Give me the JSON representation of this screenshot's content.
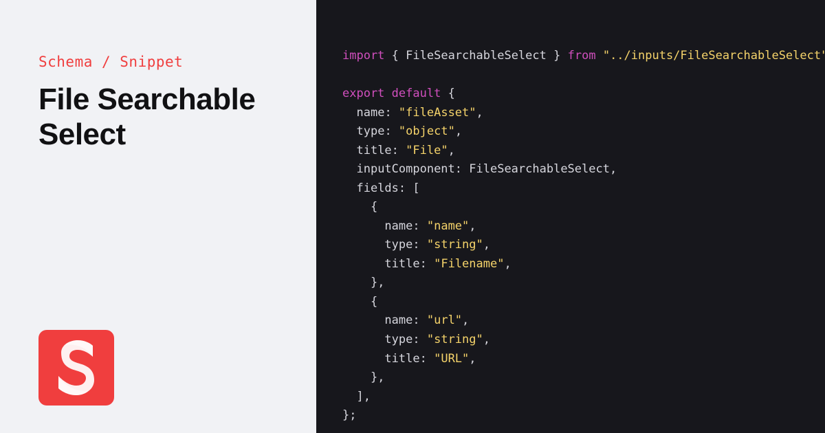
{
  "breadcrumb": {
    "category": "Schema",
    "separator": "/",
    "subcategory": "Snippet",
    "full": "Schema / Snippet"
  },
  "title": "File Searchable Select",
  "logo": {
    "letter": "S",
    "bg": "#f03e3e"
  },
  "code": {
    "import_keyword": "import",
    "import_open": "{",
    "import_symbol": "FileSearchableSelect",
    "import_close": "}",
    "from_keyword": "from",
    "import_path": "\"../inputs/FileSearchableSelect\"",
    "export_keyword": "export",
    "default_keyword": "default",
    "obj_open": "{",
    "k_name": "name",
    "v_name": "\"fileAsset\"",
    "k_type": "type",
    "v_type": "\"object\"",
    "k_title": "title",
    "v_title": "\"File\"",
    "k_inputComponent": "inputComponent",
    "v_inputComponent": "FileSearchableSelect",
    "k_fields": "fields",
    "fields_open": "[",
    "f1_open": "{",
    "f1_k_name": "name",
    "f1_v_name": "\"name\"",
    "f1_k_type": "type",
    "f1_v_type": "\"string\"",
    "f1_k_title": "title",
    "f1_v_title": "\"Filename\"",
    "f1_close": "},",
    "f2_open": "{",
    "f2_k_name": "name",
    "f2_v_name": "\"url\"",
    "f2_k_type": "type",
    "f2_v_type": "\"string\"",
    "f2_k_title": "title",
    "f2_v_title": "\"URL\"",
    "f2_close": "},",
    "fields_close": "],",
    "obj_close": "};"
  }
}
